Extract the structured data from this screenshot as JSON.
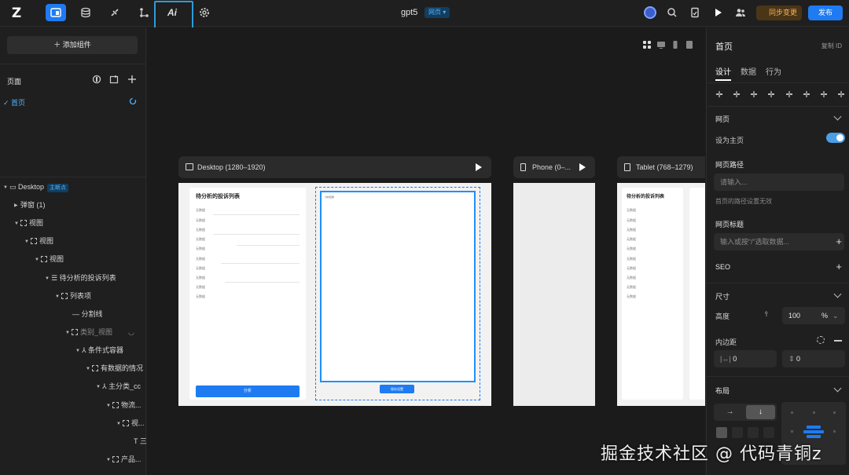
{
  "topbar": {
    "logo": "Z",
    "ai_label": "Ai",
    "doc_title": "gpt5",
    "doc_badge": "网页 ▾",
    "sync_label": "同步变更",
    "publish_label": "发布"
  },
  "left": {
    "add_component": "＋  添加组件",
    "pages_title": "页面",
    "home_page": "✓ 首页",
    "tree": [
      {
        "label": "Desktop",
        "tag": "主断点"
      },
      {
        "label": "弹窗 (1)"
      },
      {
        "label": "视图"
      },
      {
        "label": "视图"
      },
      {
        "label": "视图"
      },
      {
        "label": "待分析的投诉列表"
      },
      {
        "label": "列表项"
      },
      {
        "label": "— 分割线"
      },
      {
        "label": "类别_视图"
      },
      {
        "label": "条件式容器"
      },
      {
        "label": "有数据的情况"
      },
      {
        "label": "主分类_cc"
      },
      {
        "label": "物流..."
      },
      {
        "label": "视..."
      },
      {
        "label": "T 三"
      },
      {
        "label": "产品..."
      }
    ]
  },
  "canvas": {
    "frames": {
      "desktop": "Desktop (1280–1920)",
      "phone": "Phone (0–...",
      "tablet": "Tablet (768–1279)"
    },
    "card_title": "待分析的投诉列表",
    "row_label": "无数据",
    "analyze_button": "分析",
    "small_button": "保存设置",
    "top_label": "分析结果"
  },
  "right": {
    "title": "首页",
    "copy_id": "复制 ID",
    "tabs": [
      "设计",
      "数据",
      "行为"
    ],
    "section_web": "网页",
    "set_home": "设为主页",
    "path_label": "网页路径",
    "path_placeholder": "请输入...",
    "path_note": "首页的路径设置无效",
    "web_title_label": "网页标题",
    "web_title_placeholder": "输入或按“/”选取数据...",
    "seo": "SEO",
    "size_section": "尺寸",
    "height_label": "高度",
    "height_value": "100",
    "height_unit": "%",
    "padding_label": "内边距",
    "padding_h": "0",
    "padding_v": "0",
    "layout_section": "布局",
    "dir_row": "→",
    "dir_col": "↓"
  },
  "watermark": "掘金技术社区 @ 代码青铜z",
  "colors": {
    "accent": "#1e7bf2",
    "highlight": "#2d9cdb",
    "sync": "#f0b25a"
  }
}
